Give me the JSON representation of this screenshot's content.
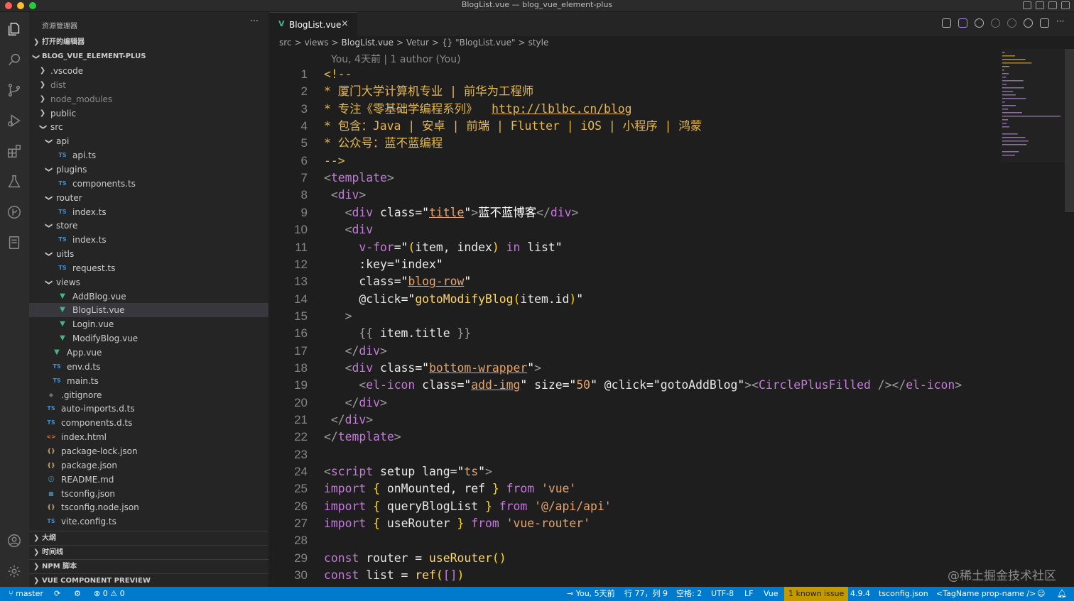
{
  "window": {
    "title": "BlogList.vue — blog_vue_element-plus",
    "traffic_colors": [
      "#ff5f57",
      "#febc2e",
      "#28c840"
    ]
  },
  "activity_bar": {
    "top_icons": [
      "files-icon",
      "search-icon",
      "source-control-icon",
      "run-debug-icon",
      "extensions-icon",
      "testing-icon",
      "git-graph-icon",
      "notebook-icon"
    ],
    "bottom_icons": [
      "account-icon",
      "settings-gear-icon"
    ]
  },
  "sidebar": {
    "title": "资源管理器",
    "more": "···",
    "open_editors": "打开的编辑器",
    "project": "BLOG_VUE_ELEMENT-PLUS",
    "tree": [
      {
        "name": ".vscode",
        "type": "folder",
        "open": false,
        "level": 1
      },
      {
        "name": "dist",
        "type": "folder",
        "open": false,
        "level": 1,
        "dim": true
      },
      {
        "name": "node_modules",
        "type": "folder",
        "open": false,
        "level": 1,
        "dim": true
      },
      {
        "name": "public",
        "type": "folder",
        "open": false,
        "level": 1
      },
      {
        "name": "src",
        "type": "folder",
        "open": true,
        "level": 1
      },
      {
        "name": "api",
        "type": "folder",
        "open": true,
        "level": 2
      },
      {
        "name": "api.ts",
        "type": "ts",
        "level": 3
      },
      {
        "name": "plugins",
        "type": "folder",
        "open": true,
        "level": 2
      },
      {
        "name": "components.ts",
        "type": "ts",
        "level": 3
      },
      {
        "name": "router",
        "type": "folder",
        "open": true,
        "level": 2
      },
      {
        "name": "index.ts",
        "type": "ts",
        "level": 3
      },
      {
        "name": "store",
        "type": "folder",
        "open": true,
        "level": 2
      },
      {
        "name": "index.ts",
        "type": "ts",
        "level": 3
      },
      {
        "name": "uitls",
        "type": "folder",
        "open": true,
        "level": 2
      },
      {
        "name": "request.ts",
        "type": "ts",
        "level": 3
      },
      {
        "name": "views",
        "type": "folder",
        "open": true,
        "level": 2
      },
      {
        "name": "AddBlog.vue",
        "type": "vue",
        "level": 3
      },
      {
        "name": "BlogList.vue",
        "type": "vue",
        "level": 3,
        "selected": true
      },
      {
        "name": "Login.vue",
        "type": "vue",
        "level": 3
      },
      {
        "name": "ModifyBlog.vue",
        "type": "vue",
        "level": 3
      },
      {
        "name": "App.vue",
        "type": "vue",
        "level": 2
      },
      {
        "name": "env.d.ts",
        "type": "ts",
        "level": 2
      },
      {
        "name": "main.ts",
        "type": "ts",
        "level": 2
      },
      {
        "name": ".gitignore",
        "type": "git",
        "level": 1
      },
      {
        "name": "auto-imports.d.ts",
        "type": "ts",
        "level": 1
      },
      {
        "name": "components.d.ts",
        "type": "ts",
        "level": 1
      },
      {
        "name": "index.html",
        "type": "html",
        "level": 1
      },
      {
        "name": "package-lock.json",
        "type": "json",
        "level": 1
      },
      {
        "name": "package.json",
        "type": "json",
        "level": 1
      },
      {
        "name": "README.md",
        "type": "info",
        "level": 1
      },
      {
        "name": "tsconfig.json",
        "type": "tsconfig",
        "level": 1
      },
      {
        "name": "tsconfig.node.json",
        "type": "json",
        "level": 1
      },
      {
        "name": "vite.config.ts",
        "type": "ts",
        "level": 1
      }
    ],
    "bottom_sections": [
      "大纲",
      "时间线",
      "NPM 脚本",
      "VUE COMPONENT PREVIEW"
    ]
  },
  "editor": {
    "tab": {
      "name": "BlogList.vue",
      "close": "×"
    },
    "breadcrumb": [
      "src",
      ">",
      "views",
      ">",
      "BlogList.vue",
      ">",
      "Vetur",
      ">",
      "{} \"BlogList.vue\"",
      ">",
      "style"
    ],
    "blame": "You, 4天前 | 1 author (You)",
    "lines": [
      {
        "n": "1",
        "tokens": [
          [
            "c-cmt",
            "<!--"
          ]
        ],
        "indent": 0
      },
      {
        "n": "2",
        "tokens": [
          [
            "c-cmt",
            "* 厦门大学计算机专业 | 前华为工程师"
          ]
        ],
        "indent": 0
      },
      {
        "n": "3",
        "tokens": [
          [
            "c-cmt",
            "* 专注《零基础学编程系列》  "
          ],
          [
            "c-url",
            "http://lblbc.cn/blog"
          ]
        ],
        "indent": 0
      },
      {
        "n": "4",
        "tokens": [
          [
            "c-cmt",
            "* 包含：Java | 安卓 | 前端 | Flutter | iOS | 小程序 | 鸿蒙"
          ]
        ],
        "indent": 0
      },
      {
        "n": "5",
        "tokens": [
          [
            "c-cmt",
            "* 公众号：蓝不蓝编程"
          ]
        ],
        "indent": 0
      },
      {
        "n": "6",
        "tokens": [
          [
            "c-cmt",
            "-->"
          ]
        ],
        "indent": 0
      },
      {
        "n": "7",
        "tokens": [
          [
            "c-gray",
            "<"
          ],
          [
            "c-tag",
            "template"
          ],
          [
            "c-gray",
            ">"
          ]
        ],
        "indent": 0
      },
      {
        "n": "8",
        "tokens": [
          [
            "c-gray",
            " <"
          ],
          [
            "c-tag",
            "div"
          ],
          [
            "c-gray",
            ">"
          ]
        ],
        "indent": 0
      },
      {
        "n": "9",
        "tokens": [
          [
            "c-gray",
            "   <"
          ],
          [
            "c-tag",
            "div"
          ],
          [
            "c-attr",
            " class"
          ],
          [
            "c-wt",
            "=\""
          ],
          [
            "c-sul",
            "title"
          ],
          [
            "c-wt",
            "\""
          ],
          [
            "c-gray",
            ">"
          ],
          [
            "c-wt",
            "蓝不蓝博客"
          ],
          [
            "c-gray",
            "</"
          ],
          [
            "c-tag",
            "div"
          ],
          [
            "c-gray",
            ">"
          ]
        ],
        "indent": 0
      },
      {
        "n": "10",
        "tokens": [
          [
            "c-gray",
            "   <"
          ],
          [
            "c-tag",
            "div"
          ]
        ],
        "indent": 0
      },
      {
        "n": "11",
        "tokens": [
          [
            "c-tag",
            "     v-for"
          ],
          [
            "c-wt",
            "=\""
          ],
          [
            "c-br",
            "("
          ],
          [
            "c-var",
            "item, index"
          ],
          [
            "c-br",
            ")"
          ],
          [
            "c-kw",
            " in "
          ],
          [
            "c-var",
            "list"
          ],
          [
            "c-wt",
            "\""
          ]
        ],
        "indent": 0
      },
      {
        "n": "12",
        "tokens": [
          [
            "c-attr",
            "     :key"
          ],
          [
            "c-wt",
            "=\""
          ],
          [
            "c-var",
            "index"
          ],
          [
            "c-wt",
            "\""
          ]
        ],
        "indent": 0
      },
      {
        "n": "13",
        "tokens": [
          [
            "c-attr",
            "     class"
          ],
          [
            "c-wt",
            "=\""
          ],
          [
            "c-sul",
            "blog-row"
          ],
          [
            "c-wt",
            "\""
          ]
        ],
        "indent": 0
      },
      {
        "n": "14",
        "tokens": [
          [
            "c-attr",
            "     @click"
          ],
          [
            "c-wt",
            "=\""
          ],
          [
            "c-fn",
            "gotoModifyBlog"
          ],
          [
            "c-br",
            "("
          ],
          [
            "c-var",
            "item.id"
          ],
          [
            "c-br",
            ")"
          ],
          [
            "c-wt",
            "\""
          ]
        ],
        "indent": 0
      },
      {
        "n": "15",
        "tokens": [
          [
            "c-gray",
            "   >"
          ]
        ],
        "indent": 0
      },
      {
        "n": "16",
        "tokens": [
          [
            "c-gray",
            "     {{ "
          ],
          [
            "c-var",
            "item.title"
          ],
          [
            "c-gray",
            " }}"
          ]
        ],
        "indent": 0
      },
      {
        "n": "17",
        "tokens": [
          [
            "c-gray",
            "   </"
          ],
          [
            "c-tag",
            "div"
          ],
          [
            "c-gray",
            ">"
          ]
        ],
        "indent": 0
      },
      {
        "n": "18",
        "tokens": [
          [
            "c-gray",
            "   <"
          ],
          [
            "c-tag",
            "div"
          ],
          [
            "c-attr",
            " class"
          ],
          [
            "c-wt",
            "=\""
          ],
          [
            "c-sul",
            "bottom-wrapper"
          ],
          [
            "c-wt",
            "\""
          ],
          [
            "c-gray",
            ">"
          ]
        ],
        "indent": 0
      },
      {
        "n": "19",
        "tokens": [
          [
            "c-gray",
            "     <"
          ],
          [
            "c-tag",
            "el-icon"
          ],
          [
            "c-attr",
            " class"
          ],
          [
            "c-wt",
            "=\""
          ],
          [
            "c-sul",
            "add-img"
          ],
          [
            "c-wt",
            "\""
          ],
          [
            "c-attr",
            " size"
          ],
          [
            "c-wt",
            "=\""
          ],
          [
            "c-str",
            "50"
          ],
          [
            "c-wt",
            "\""
          ],
          [
            "c-attr",
            " @click"
          ],
          [
            "c-wt",
            "=\""
          ],
          [
            "c-var",
            "gotoAddBlog"
          ],
          [
            "c-wt",
            "\""
          ],
          [
            "c-gray",
            "><"
          ],
          [
            "c-comp",
            "CirclePlusFilled"
          ],
          [
            "c-gray",
            " /></"
          ],
          [
            "c-tag",
            "el-icon"
          ],
          [
            "c-gray",
            ">"
          ]
        ],
        "indent": 0
      },
      {
        "n": "20",
        "tokens": [
          [
            "c-gray",
            "   </"
          ],
          [
            "c-tag",
            "div"
          ],
          [
            "c-gray",
            ">"
          ]
        ],
        "indent": 0
      },
      {
        "n": "21",
        "tokens": [
          [
            "c-gray",
            " </"
          ],
          [
            "c-tag",
            "div"
          ],
          [
            "c-gray",
            ">"
          ]
        ],
        "indent": 0
      },
      {
        "n": "22",
        "tokens": [
          [
            "c-gray",
            "</"
          ],
          [
            "c-tag",
            "template"
          ],
          [
            "c-gray",
            ">"
          ]
        ],
        "indent": -1
      },
      {
        "n": "23",
        "tokens": [],
        "indent": 0
      },
      {
        "n": "24",
        "tokens": [
          [
            "c-gray",
            "<"
          ],
          [
            "c-tag",
            "script"
          ],
          [
            "c-attr",
            " setup lang"
          ],
          [
            "c-wt",
            "=\""
          ],
          [
            "c-str",
            "ts"
          ],
          [
            "c-wt",
            "\""
          ],
          [
            "c-gray",
            ">"
          ]
        ],
        "indent": -1
      },
      {
        "n": "25",
        "tokens": [
          [
            "c-kw",
            "import "
          ],
          [
            "c-br",
            "{ "
          ],
          [
            "c-var",
            "onMounted, ref "
          ],
          [
            "c-br",
            "}"
          ],
          [
            "c-kw",
            " from "
          ],
          [
            "c-str",
            "'vue'"
          ]
        ],
        "indent": -1
      },
      {
        "n": "26",
        "tokens": [
          [
            "c-kw",
            "import "
          ],
          [
            "c-br",
            "{ "
          ],
          [
            "c-var",
            "queryBlogList "
          ],
          [
            "c-br",
            "}"
          ],
          [
            "c-kw",
            " from "
          ],
          [
            "c-str",
            "'@/api/api'"
          ]
        ],
        "indent": -1
      },
      {
        "n": "27",
        "tokens": [
          [
            "c-kw",
            "import "
          ],
          [
            "c-br",
            "{ "
          ],
          [
            "c-var",
            "useRouter "
          ],
          [
            "c-br",
            "}"
          ],
          [
            "c-kw",
            " from "
          ],
          [
            "c-str",
            "'vue-router'"
          ]
        ],
        "indent": -1
      },
      {
        "n": "28",
        "tokens": [],
        "indent": 0
      },
      {
        "n": "29",
        "tokens": [
          [
            "c-kw",
            "const "
          ],
          [
            "c-var",
            "router = "
          ],
          [
            "c-fn",
            "useRouter"
          ],
          [
            "c-br",
            "()"
          ]
        ],
        "indent": -1
      },
      {
        "n": "30",
        "tokens": [
          [
            "c-kw",
            "const "
          ],
          [
            "c-var",
            "list = "
          ],
          [
            "c-fn",
            "ref"
          ],
          [
            "c-br",
            "("
          ],
          [
            "c-tag",
            "[]"
          ],
          [
            "c-br",
            ")"
          ]
        ],
        "indent": -1
      }
    ]
  },
  "watermark": "@稀土掘金技术社区",
  "status": {
    "branch": "master",
    "sync": "⟳",
    "errors": "⊗ 0 ⚠ 0",
    "blame": "You, 5天前",
    "position": "行 77，列 9",
    "spaces": "空格: 2",
    "encoding": "UTF-8",
    "eol": "LF",
    "language": "Vue",
    "issue": "1 known issue",
    "ts_version": "4.9.4",
    "tsconfig": "tsconfig.json",
    "tag_hint": "<TagName prop-name />"
  },
  "colors": {
    "accent": "#007acc",
    "vue_green": "#41b883",
    "ts_blue": "#3f8fd2"
  }
}
